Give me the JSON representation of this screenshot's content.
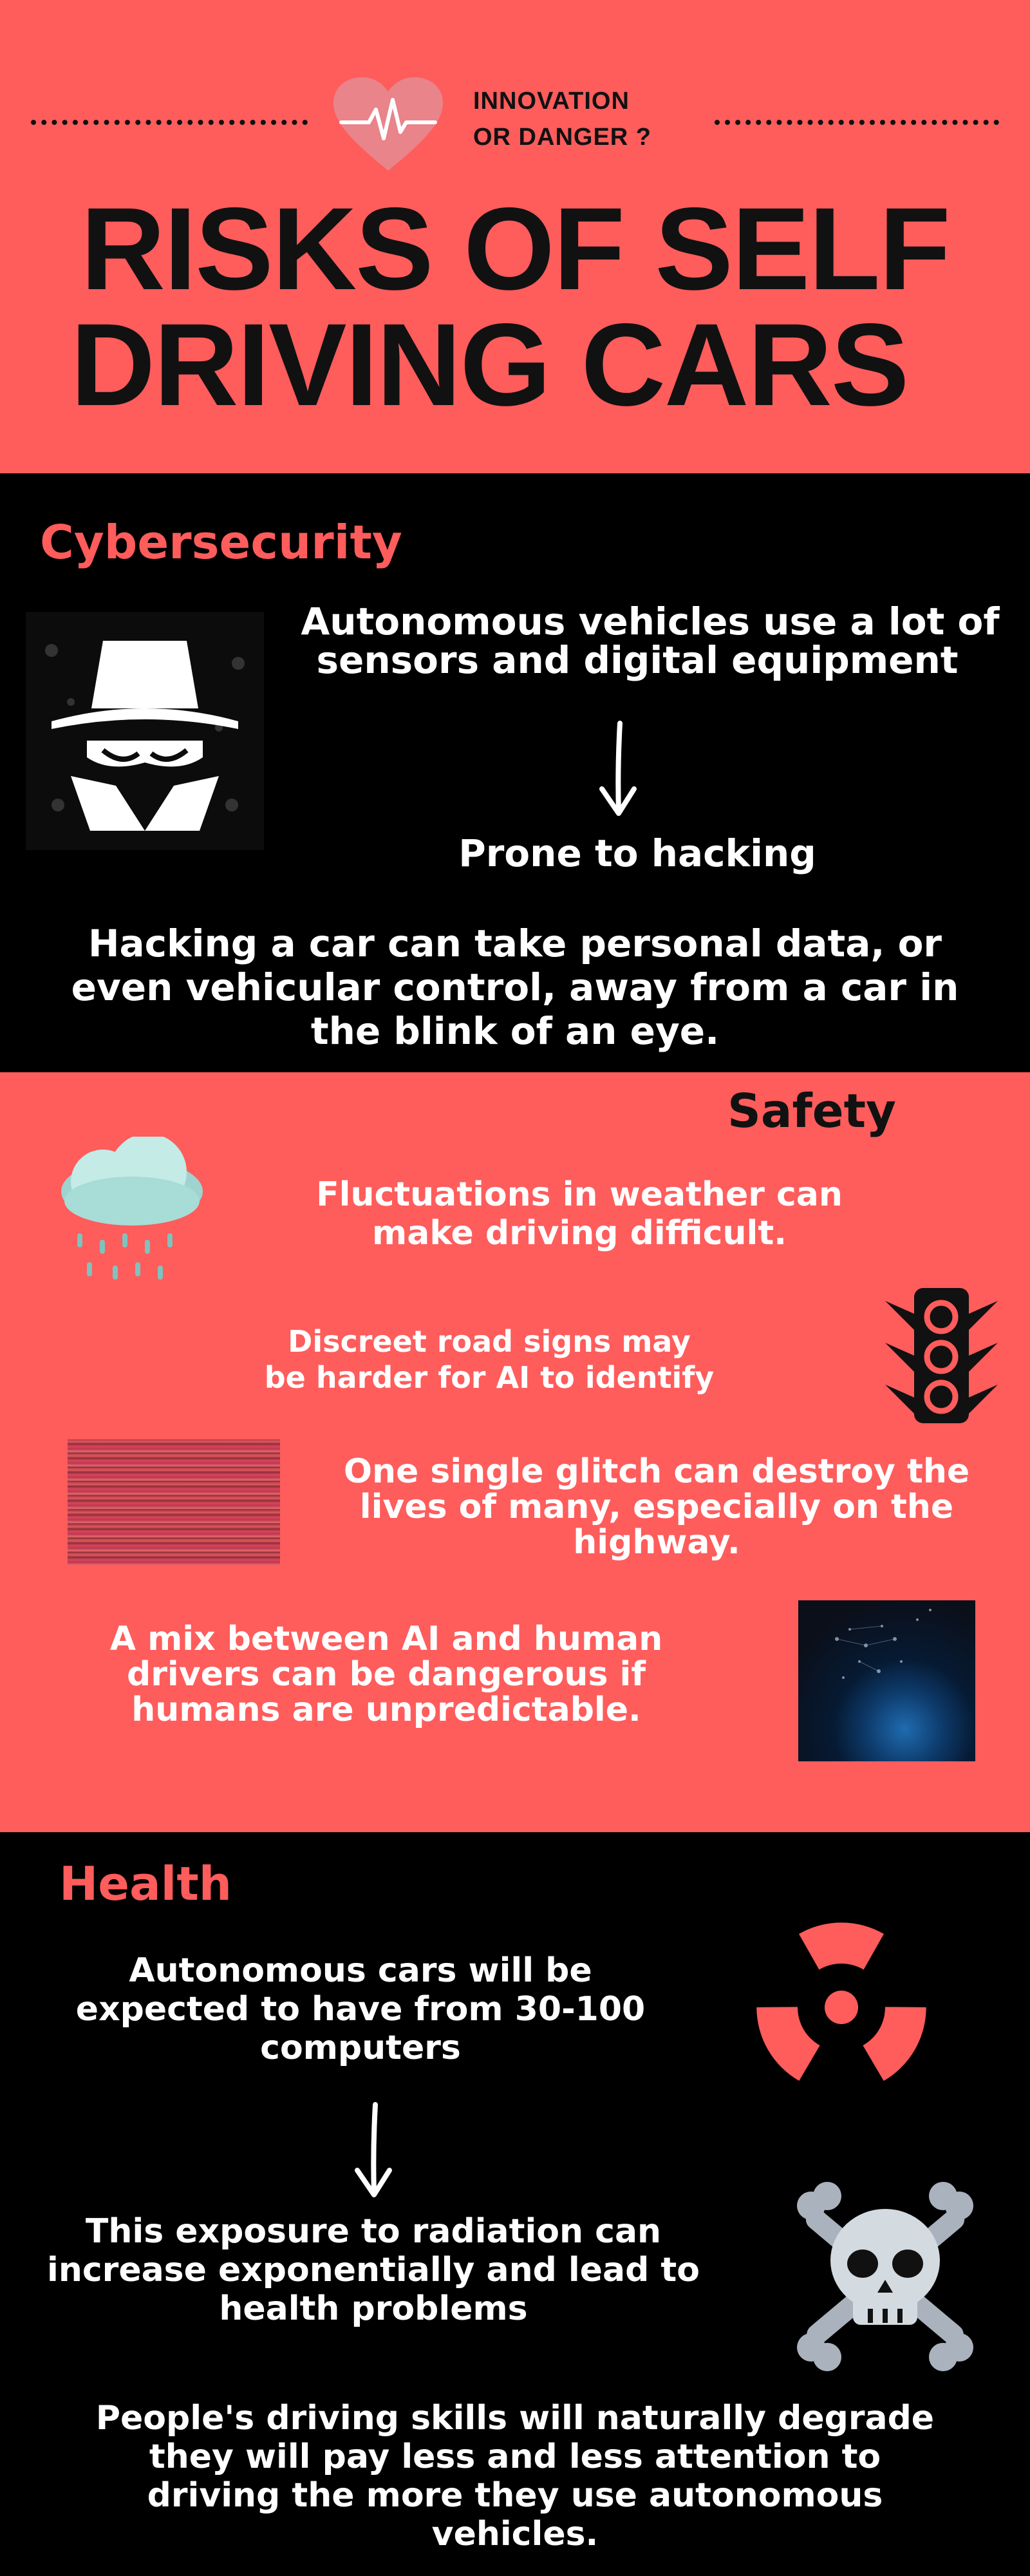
{
  "header": {
    "kicker_line1": "INNOVATION",
    "kicker_line2": "OR DANGER ?",
    "title_line1": "RISKS OF SELF",
    "title_line2": "DRIVING CARS",
    "heart_icon": "heart-pulse-icon"
  },
  "cybersecurity": {
    "title": "Cybersecurity",
    "sensors_line1": "Autonomous vehicles use a lot of",
    "sensors_line2": "sensors and digital equipment",
    "prone": "Prone to hacking",
    "hack_line1": "Hacking a car can take personal data, or",
    "hack_line2": "even vehicular control, away from a car in",
    "hack_line3": "the blink of an eye.",
    "icon": "hacker-icon"
  },
  "safety": {
    "title": "Safety",
    "weather_line1": "Fluctuations in weather can",
    "weather_line2": "make driving difficult.",
    "signs_line1": "Discreet road signs may",
    "signs_line2": "be harder for AI to identify",
    "glitch_line1": "One single glitch can destroy the",
    "glitch_line2": "lives of many, especially on the",
    "glitch_line3": "highway.",
    "mix_line1": "A mix between AI and human",
    "mix_line2": "drivers can be dangerous if",
    "mix_line3": "humans are unpredictable.",
    "icons": [
      "rain-cloud-icon",
      "traffic-light-icon"
    ]
  },
  "health": {
    "title": "Health",
    "computers_line1": "Autonomous cars will be",
    "computers_line2": "expected to have from 30-100",
    "computers_line3": "computers",
    "radiation_line1": "This exposure to radiation can",
    "radiation_line2": "increase exponentially and lead to",
    "radiation_line3": "health problems",
    "skills_line1": "People's driving skills will naturally degrade",
    "skills_line2": "they will pay less and less attention to",
    "skills_line3": "driving the more they use autonomous",
    "skills_line4": "vehicles.",
    "icons": [
      "radiation-icon",
      "skull-crossbones-icon"
    ]
  },
  "colors": {
    "coral": "#ff5c5c",
    "black": "#000000",
    "white": "#ffffff"
  }
}
